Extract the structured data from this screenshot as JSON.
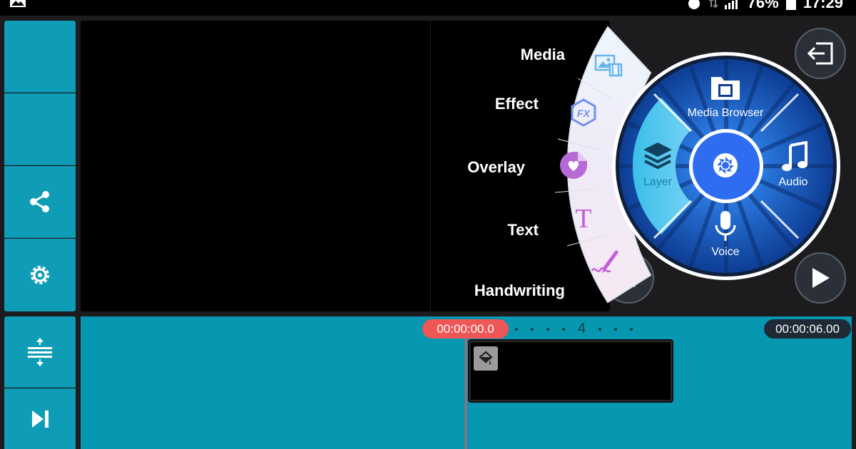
{
  "status_bar": {
    "battery_percent": "76%",
    "time": "17:29"
  },
  "sidebar": {
    "items": [
      {
        "id": "blank-1"
      },
      {
        "id": "blank-2"
      },
      {
        "id": "share",
        "icon": "share-icon"
      },
      {
        "id": "settings",
        "icon": "gear-icon"
      },
      {
        "id": "adjust-tracks",
        "icon": "track-height-icon"
      },
      {
        "id": "jump-end",
        "icon": "skip-to-end-icon"
      }
    ]
  },
  "arc_menu": {
    "items": [
      {
        "label": "Media",
        "icon": "media-icon"
      },
      {
        "label": "Effect",
        "icon": "fx-icon"
      },
      {
        "label": "Overlay",
        "icon": "sticker-icon"
      },
      {
        "label": "Text",
        "icon": "text-icon"
      },
      {
        "label": "Handwriting",
        "icon": "handwriting-icon"
      }
    ]
  },
  "wheel": {
    "media_browser": "Media Browser",
    "layer": "Layer",
    "audio": "Audio",
    "voice": "Voice",
    "center_icon": "camera-shutter-icon"
  },
  "timeline": {
    "playhead_time": "00:00:00.0",
    "end_time": "00:00:06.00",
    "ruler_mark": "4"
  },
  "colors": {
    "accent": "#0e9cb6",
    "playhead": "#ef5656",
    "wheel_blue": "#1d5fcf",
    "wheel_center": "#2e6cf0"
  }
}
